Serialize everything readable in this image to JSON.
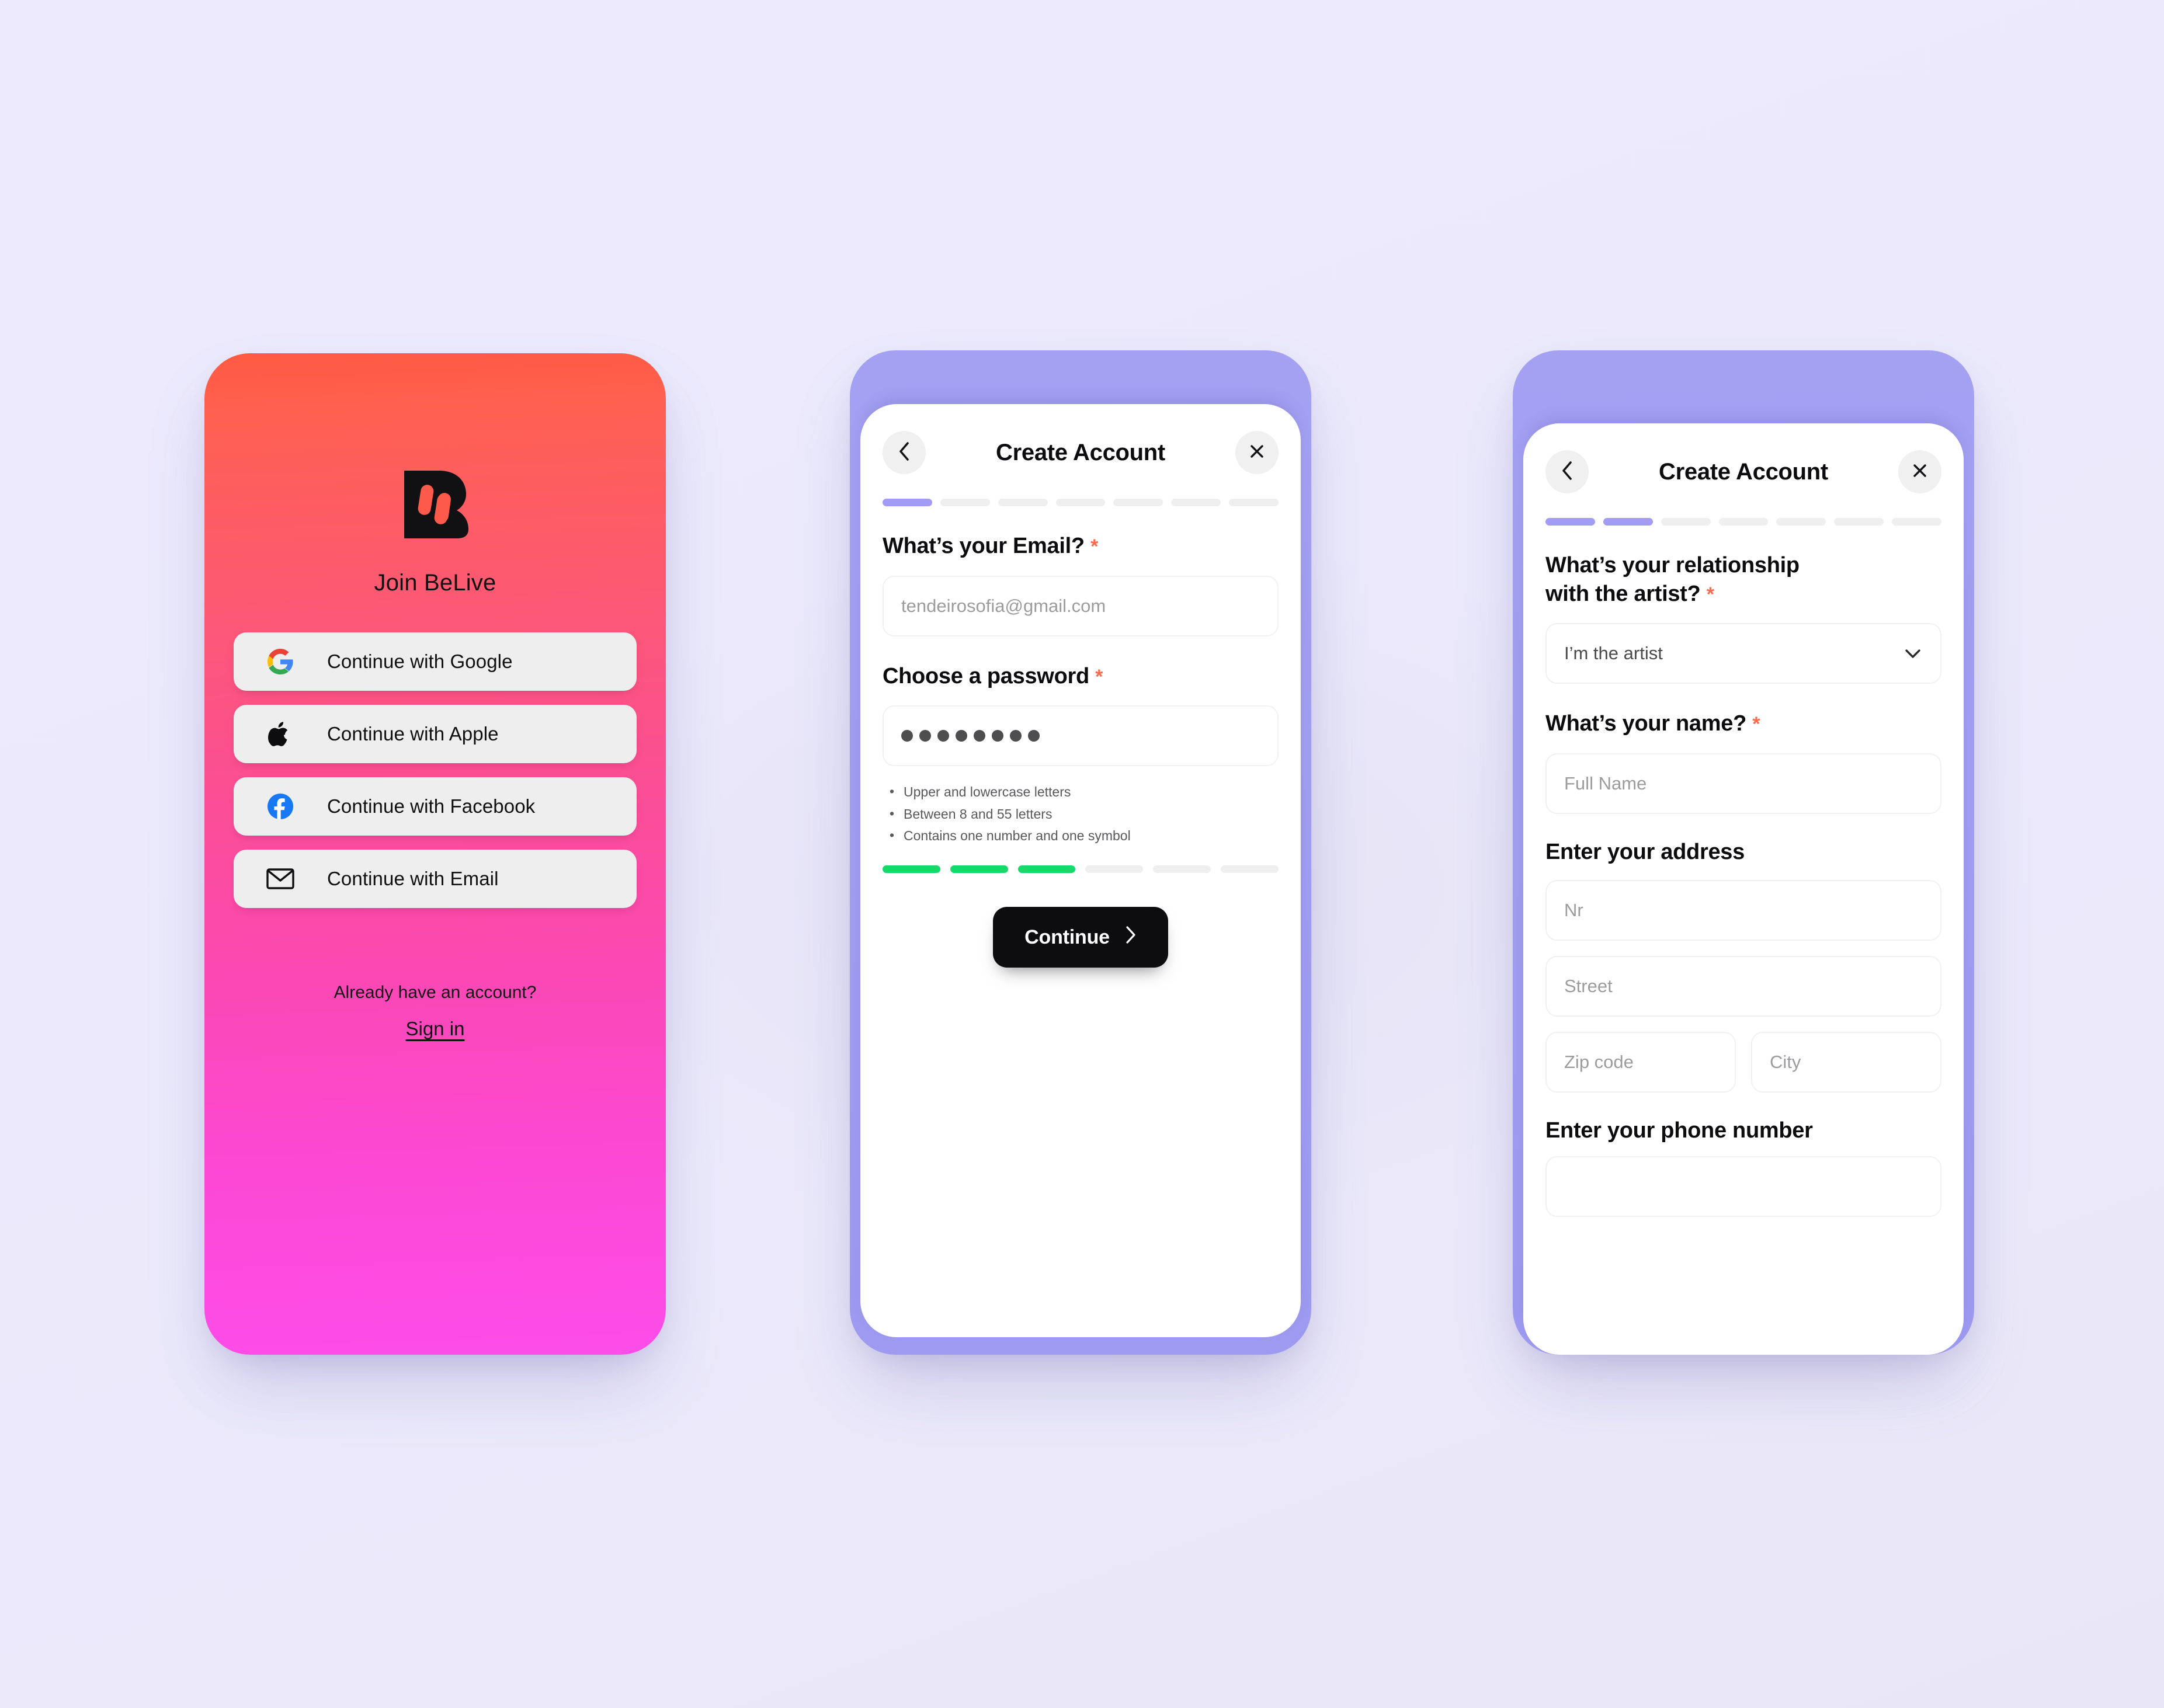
{
  "theme": {
    "page_bg": "#ebe9fb",
    "phone1_gradient_start": "#ff5a43",
    "phone1_gradient_end": "#fd4de9",
    "phone_shell_periwinkle": "#a4a1f3",
    "accent_purple": "#a29cf5",
    "accent_green": "#16d96a",
    "required_star": "#fd6a4e",
    "button_black": "#0d0d0f"
  },
  "phone1": {
    "logo_icon": "belive-b-logo",
    "title": "Join BeLive",
    "sso_buttons": [
      {
        "icon": "google-icon",
        "label": "Continue with Google"
      },
      {
        "icon": "apple-icon",
        "label": "Continue with Apple"
      },
      {
        "icon": "facebook-icon",
        "label": "Continue with Facebook"
      },
      {
        "icon": "email-icon",
        "label": "Continue with Email"
      }
    ],
    "already_have_account": "Already have an account?",
    "sign_in": "Sign in"
  },
  "phone2": {
    "nav": {
      "back_icon": "chevron-left-icon",
      "title": "Create Account",
      "close_icon": "close-icon"
    },
    "progress": {
      "total": 7,
      "completed": 1
    },
    "email": {
      "question": "What’s your Email?",
      "required_mark": "*",
      "placeholder": "tendeirosofia@gmail.com",
      "value": ""
    },
    "password": {
      "question": "Choose a password",
      "required_mark": "*",
      "masked_length": 8,
      "rules": [
        "Upper and lowercase letters",
        "Between 8 and 55 letters",
        "Contains one number and one symbol"
      ],
      "strength": {
        "total": 6,
        "filled": 3
      }
    },
    "continue_label": "Continue",
    "continue_icon": "chevron-right-icon"
  },
  "phone3": {
    "nav": {
      "back_icon": "chevron-left-icon",
      "title": "Create Account",
      "close_icon": "close-icon"
    },
    "progress": {
      "total": 7,
      "completed": 2
    },
    "relationship": {
      "question_line1": "What’s your relationship",
      "question_line2": "with the artist?",
      "required_mark": "*",
      "selected": "I’m the artist",
      "chevron_icon": "chevron-down-icon"
    },
    "name": {
      "question": "What’s your name?",
      "required_mark": "*",
      "placeholder": "Full Name",
      "value": ""
    },
    "address": {
      "heading": "Enter your address",
      "nr_placeholder": "Nr",
      "street_placeholder": "Street",
      "zip_placeholder": "Zip code",
      "city_placeholder": "City"
    },
    "phone_section": {
      "heading": "Enter your phone number"
    }
  }
}
